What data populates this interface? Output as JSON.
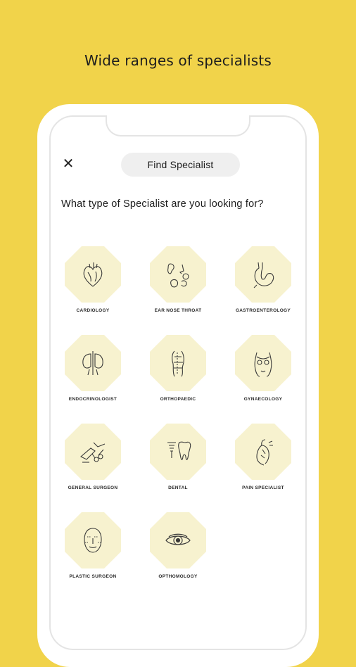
{
  "headline": "Wide ranges of specialists",
  "header": {
    "close_symbol": "✕",
    "title": "Find Specialist"
  },
  "question": "What type of Specialist are you looking for?",
  "specialists": [
    {
      "label": "CARDIOLOGY",
      "icon": "heart-icon"
    },
    {
      "label": "EAR NOSE THROAT",
      "icon": "ear-nose-throat-icon"
    },
    {
      "label": "GASTROENTEROLOGY",
      "icon": "stomach-icon"
    },
    {
      "label": "ENDOCRINOLOGIST",
      "icon": "endocrine-icon"
    },
    {
      "label": "ORTHOPAEDIC",
      "icon": "bone-icon"
    },
    {
      "label": "GYNAECOLOGY",
      "icon": "torso-icon"
    },
    {
      "label": "GENERAL SURGEON",
      "icon": "surgical-tools-icon"
    },
    {
      "label": "DENTAL",
      "icon": "tooth-icon"
    },
    {
      "label": "PAIN SPECIALIST",
      "icon": "pain-body-icon"
    },
    {
      "label": "PLASTIC SURGEON",
      "icon": "face-icon"
    },
    {
      "label": "OPTHOMOLOGY",
      "icon": "eye-icon"
    }
  ],
  "colors": {
    "background": "#f1d34a",
    "tile": "#f7f2cf"
  }
}
